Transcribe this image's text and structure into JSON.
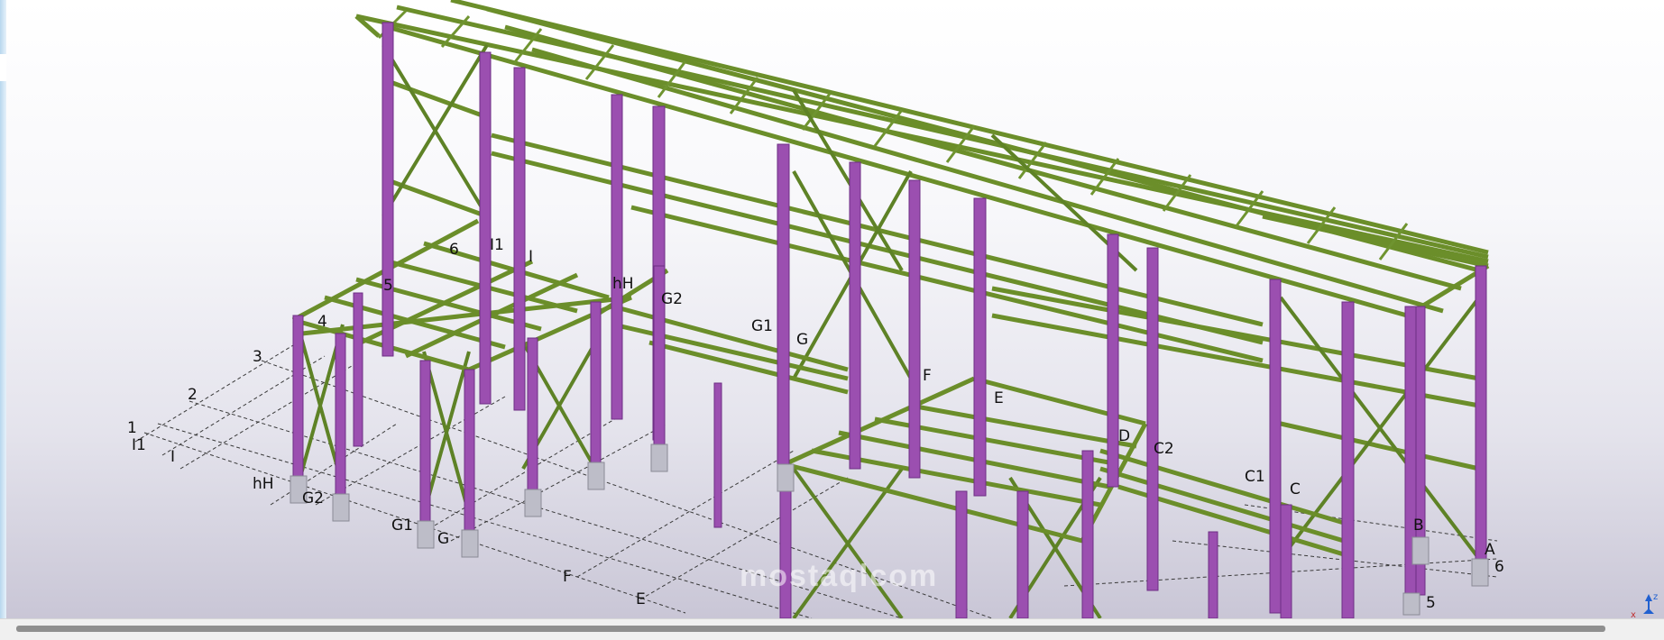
{
  "app": {
    "view": "3D model view"
  },
  "colors": {
    "beam": "#6b8e2a",
    "column": "#9b4fb0",
    "grid_line": "#333333",
    "background_top": "#ffffff",
    "background_bottom": "#c9c6d6"
  },
  "grid_labels": [
    {
      "id": "g1",
      "text": "1"
    },
    {
      "id": "g2",
      "text": "I1"
    },
    {
      "id": "g3",
      "text": "I"
    },
    {
      "id": "g4",
      "text": "2"
    },
    {
      "id": "g5",
      "text": "3"
    },
    {
      "id": "g6",
      "text": "4"
    },
    {
      "id": "g7",
      "text": "5"
    },
    {
      "id": "g8",
      "text": "6"
    },
    {
      "id": "g9",
      "text": "I1"
    },
    {
      "id": "g10",
      "text": "I"
    },
    {
      "id": "g11",
      "text": "hH"
    },
    {
      "id": "g12",
      "text": "hH"
    },
    {
      "id": "g13",
      "text": "G2"
    },
    {
      "id": "g14",
      "text": "G2"
    },
    {
      "id": "g15",
      "text": "G1"
    },
    {
      "id": "g16",
      "text": "G"
    },
    {
      "id": "g17",
      "text": "G1"
    },
    {
      "id": "g18",
      "text": "G"
    },
    {
      "id": "g19",
      "text": "F"
    },
    {
      "id": "g20",
      "text": "E"
    },
    {
      "id": "g21",
      "text": "F"
    },
    {
      "id": "g22",
      "text": "E"
    },
    {
      "id": "g23",
      "text": "D"
    },
    {
      "id": "g24",
      "text": "C2"
    },
    {
      "id": "g25",
      "text": "C1"
    },
    {
      "id": "g26",
      "text": "C"
    },
    {
      "id": "g27",
      "text": "B"
    },
    {
      "id": "g28",
      "text": "A"
    },
    {
      "id": "g29",
      "text": "6"
    },
    {
      "id": "g30",
      "text": "5"
    }
  ],
  "axis": {
    "z": "z",
    "x": "x"
  },
  "watermark": "mostaqlcom"
}
